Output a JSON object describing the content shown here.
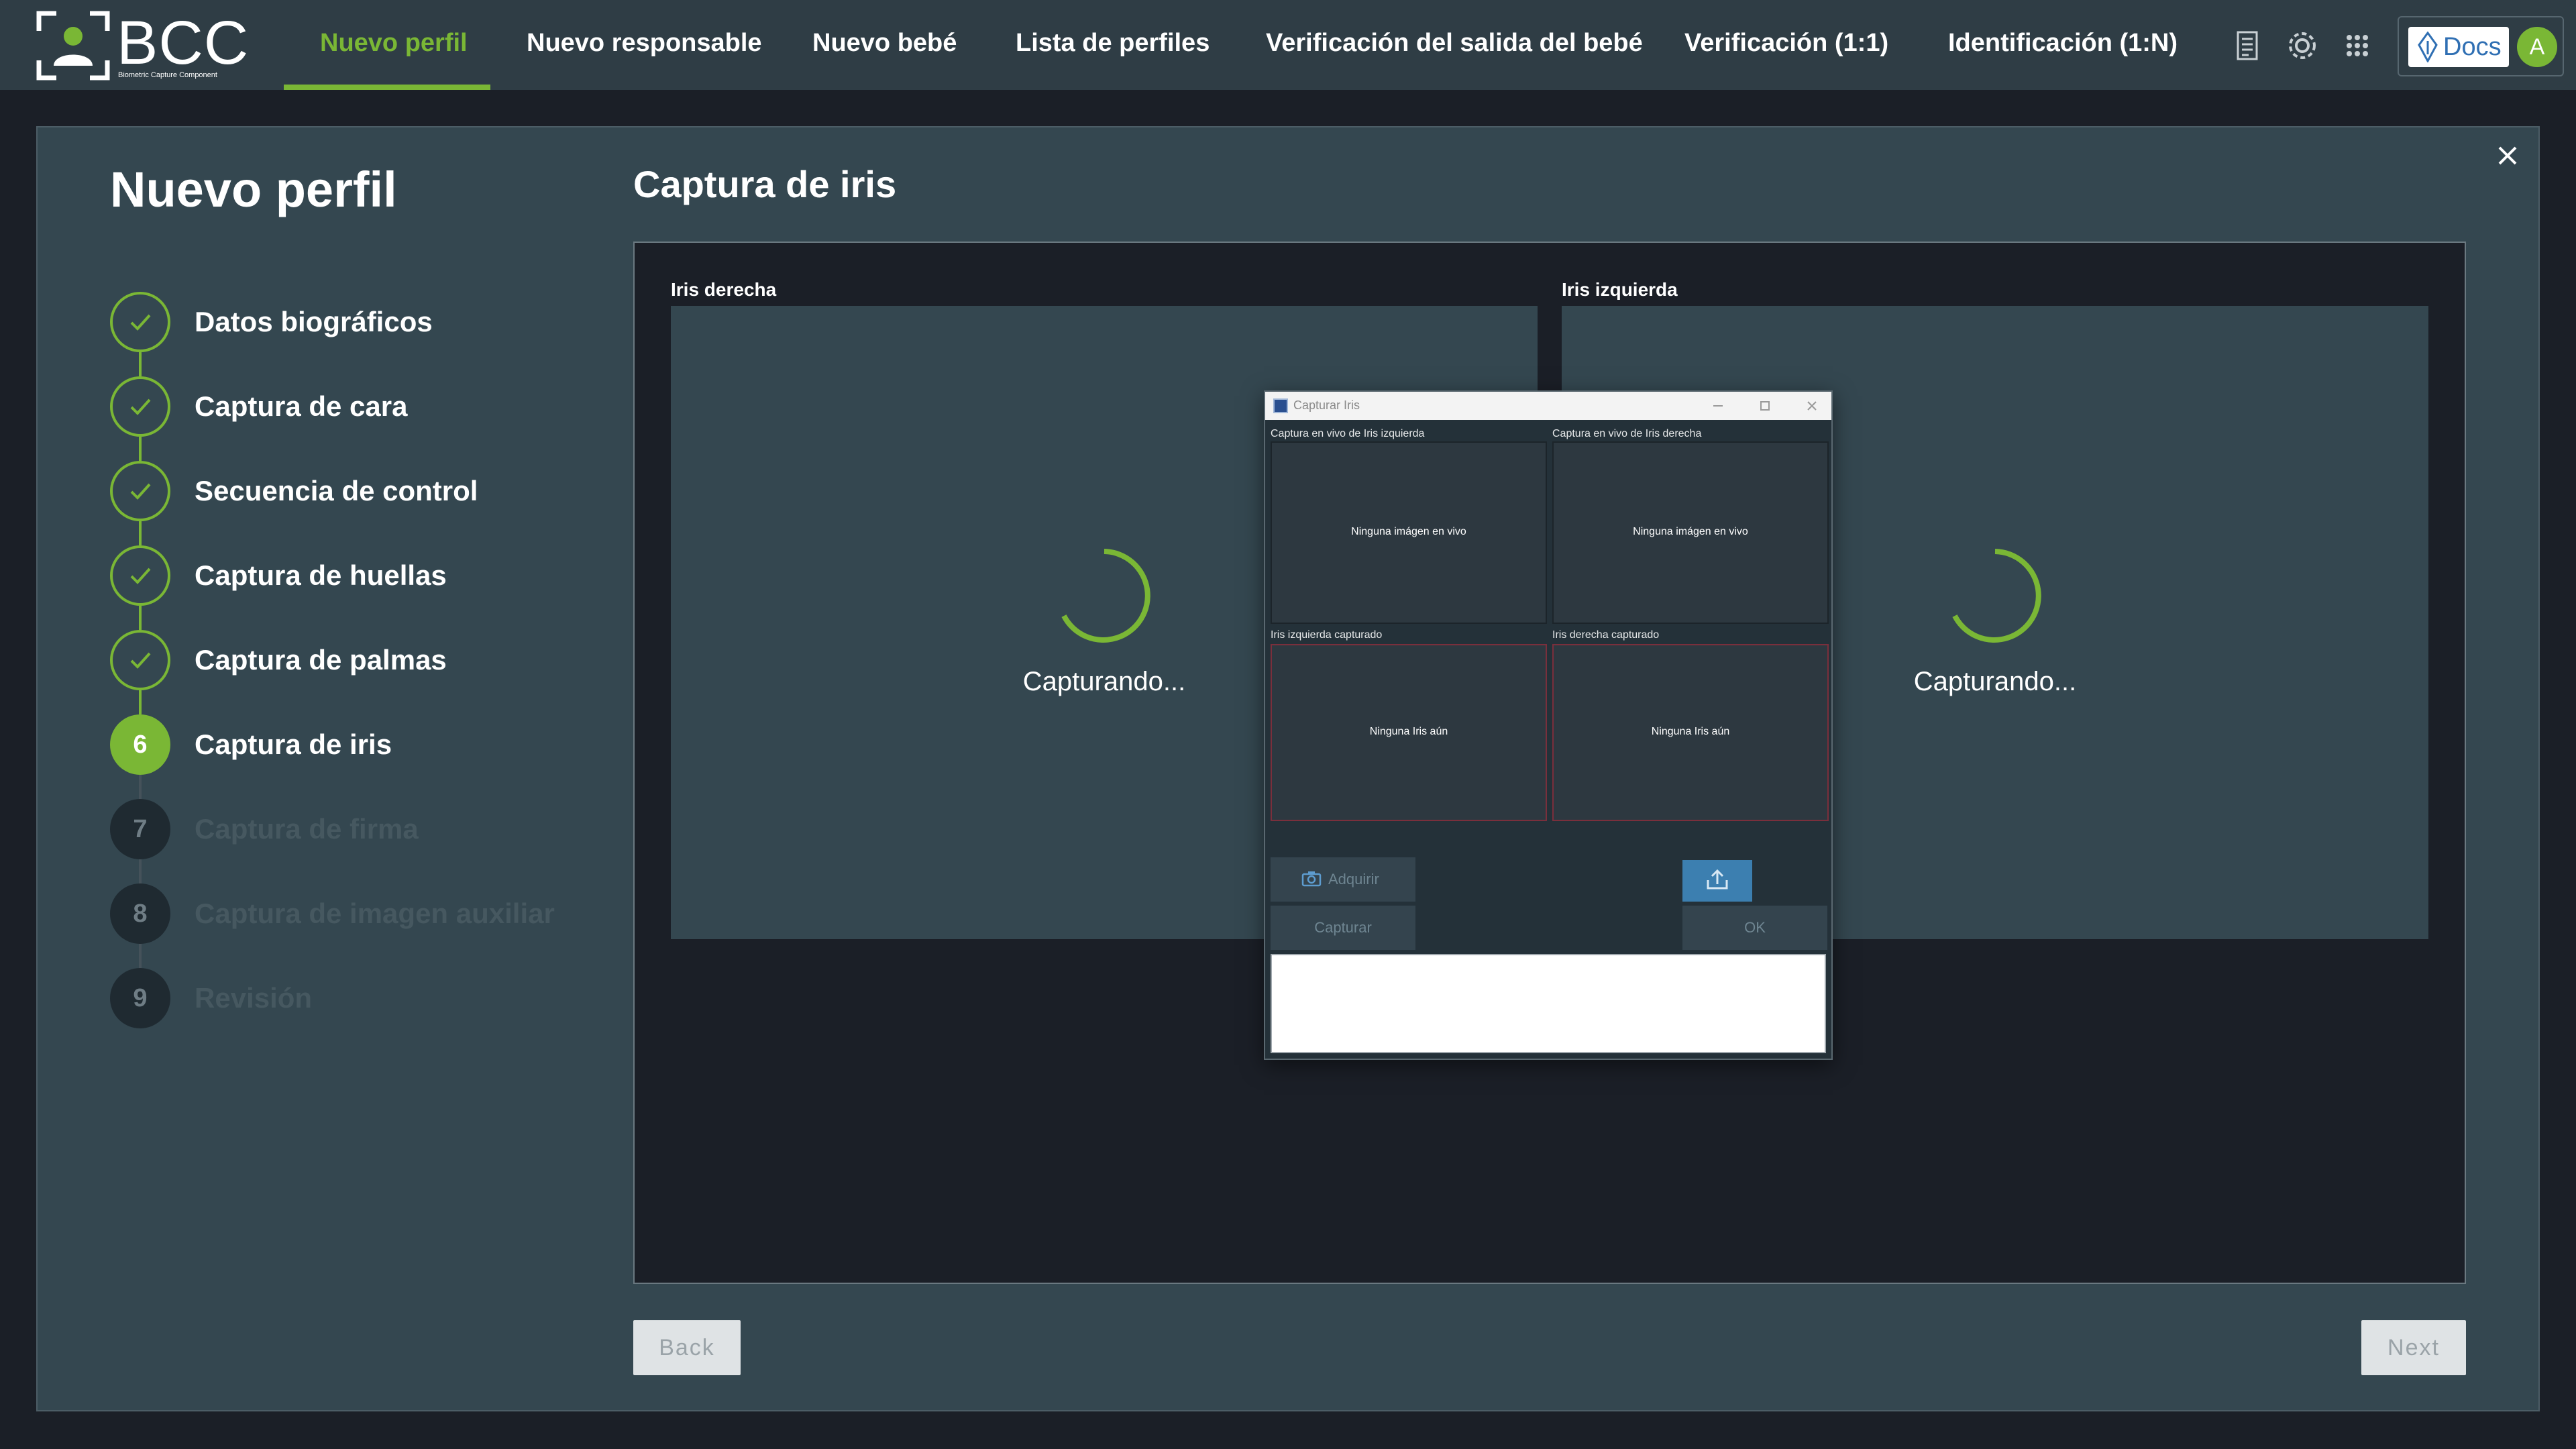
{
  "app": {
    "logo_text": "BCC",
    "logo_subtitle": "Biometric Capture Component"
  },
  "nav": {
    "items": [
      {
        "label": "Nuevo perfil",
        "active": true
      },
      {
        "label": "Nuevo responsable",
        "active": false
      },
      {
        "label": "Nuevo bebé",
        "active": false
      },
      {
        "label": "Lista de perfiles",
        "active": false
      },
      {
        "label": "Verificación del salida del bebé",
        "active": false
      },
      {
        "label": "Verificación (1:1)",
        "active": false
      },
      {
        "label": "Identificación (1:N)",
        "active": false
      }
    ],
    "docs_label": "Docs",
    "avatar_initial": "A",
    "icons": [
      "document-icon",
      "gear-icon",
      "grid-icon"
    ]
  },
  "page": {
    "title": "Nuevo perfil",
    "section_title": "Captura de iris"
  },
  "steps": [
    {
      "number": "1",
      "label": "Datos biográficos",
      "status": "done"
    },
    {
      "number": "2",
      "label": "Captura de cara",
      "status": "done"
    },
    {
      "number": "3",
      "label": "Secuencia de control",
      "status": "done"
    },
    {
      "number": "4",
      "label": "Captura de huellas",
      "status": "done"
    },
    {
      "number": "5",
      "label": "Captura de palmas",
      "status": "done"
    },
    {
      "number": "6",
      "label": "Captura de iris",
      "status": "current"
    },
    {
      "number": "7",
      "label": "Captura de firma",
      "status": "pending"
    },
    {
      "number": "8",
      "label": "Captura de imagen auxiliar",
      "status": "pending"
    },
    {
      "number": "9",
      "label": "Revisión",
      "status": "pending"
    }
  ],
  "capture": {
    "right": {
      "label": "Iris derecha",
      "status": "Capturando..."
    },
    "left": {
      "label": "Iris izquierda",
      "status": "Capturando..."
    }
  },
  "buttons": {
    "back": "Back",
    "next": "Next"
  },
  "dialog": {
    "title": "Capturar Iris",
    "live_left_label": "Captura en vivo de Iris izquierda",
    "live_right_label": "Captura en vivo de Iris derecha",
    "live_left_text": "Ninguna imágen en vivo",
    "live_right_text": "Ninguna imágen en vivo",
    "captured_left_label": "Iris izquierda capturado",
    "captured_right_label": "Iris derecha capturado",
    "captured_left_text": "Ninguna Iris aún",
    "captured_right_text": "Ninguna Iris aún",
    "acquire_label": "Adquirir",
    "capture_label": "Capturar",
    "ok_label": "OK"
  },
  "colors": {
    "accent": "#7ab735",
    "topbar": "#2f3d45",
    "card": "#344750",
    "background": "#1b1f27"
  }
}
